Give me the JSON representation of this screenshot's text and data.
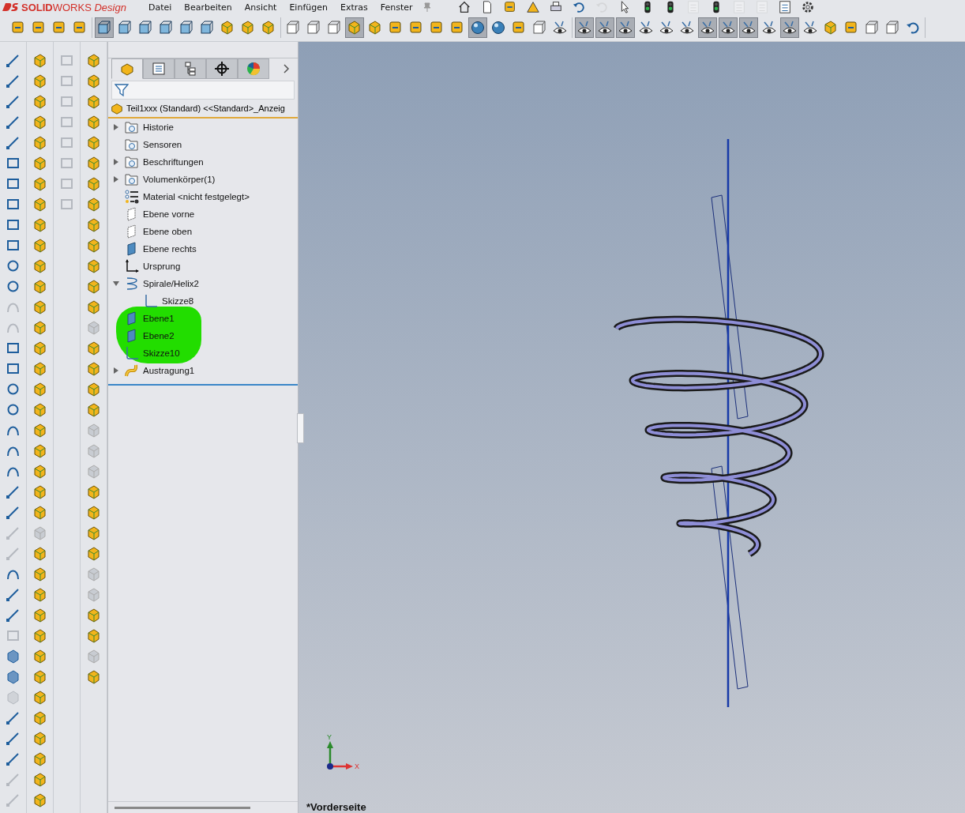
{
  "app": {
    "logo": "**SOLID**WORKS *Design*"
  },
  "menu": [
    "Datei",
    "Bearbeiten",
    "Ansicht",
    "Einfügen",
    "Extras",
    "Fenster"
  ],
  "quick_access": [
    {
      "kind": "home",
      "disabled": false
    },
    {
      "kind": "doc",
      "disabled": false
    },
    {
      "kind": "tool",
      "disabled": false
    },
    {
      "kind": "warn",
      "disabled": false
    },
    {
      "kind": "print",
      "disabled": false
    },
    {
      "kind": "undo",
      "disabled": false
    },
    {
      "kind": "undo",
      "disabled": true
    },
    {
      "kind": "cursor",
      "disabled": false
    },
    {
      "kind": "light",
      "disabled": false
    },
    {
      "kind": "light",
      "disabled": false
    },
    {
      "kind": "list",
      "disabled": true
    },
    {
      "kind": "light",
      "disabled": false
    },
    {
      "kind": "list",
      "disabled": true
    },
    {
      "kind": "list",
      "disabled": true
    },
    {
      "kind": "list",
      "disabled": false
    },
    {
      "kind": "gear",
      "disabled": false
    }
  ],
  "toolbar": [
    [
      {
        "kind": "tool",
        "pressed": false
      },
      {
        "kind": "tool",
        "pressed": false
      },
      {
        "kind": "tool",
        "pressed": false
      },
      {
        "kind": "tool",
        "pressed": false
      }
    ],
    [
      {
        "kind": "view",
        "pressed": true
      },
      {
        "kind": "view",
        "pressed": false
      },
      {
        "kind": "view",
        "pressed": false
      },
      {
        "kind": "view",
        "pressed": false
      },
      {
        "kind": "view",
        "pressed": false
      },
      {
        "kind": "view",
        "pressed": false
      },
      {
        "kind": "solid",
        "pressed": false
      },
      {
        "kind": "solid",
        "pressed": false
      },
      {
        "kind": "solid",
        "pressed": false
      }
    ],
    [
      {
        "kind": "wire",
        "pressed": false
      },
      {
        "kind": "wire",
        "pressed": false
      },
      {
        "kind": "wire",
        "pressed": false
      },
      {
        "kind": "solid",
        "pressed": true
      },
      {
        "kind": "solid",
        "pressed": false
      },
      {
        "kind": "tool",
        "pressed": false
      },
      {
        "kind": "tool",
        "pressed": false
      },
      {
        "kind": "tool",
        "pressed": false
      },
      {
        "kind": "tool",
        "pressed": false
      },
      {
        "kind": "sphere",
        "pressed": true
      },
      {
        "kind": "sphere",
        "pressed": false
      },
      {
        "kind": "tool",
        "pressed": false
      },
      {
        "kind": "wire",
        "pressed": false
      },
      {
        "kind": "eye",
        "pressed": false
      }
    ],
    [
      {
        "kind": "eye",
        "pressed": true
      },
      {
        "kind": "eye",
        "pressed": true
      },
      {
        "kind": "eye",
        "pressed": true
      },
      {
        "kind": "eye",
        "pressed": false
      },
      {
        "kind": "eye",
        "pressed": false
      },
      {
        "kind": "eye",
        "pressed": false
      },
      {
        "kind": "eye",
        "pressed": true
      },
      {
        "kind": "eye",
        "pressed": true
      },
      {
        "kind": "eye",
        "pressed": true
      },
      {
        "kind": "eye",
        "pressed": false
      },
      {
        "kind": "eye",
        "pressed": true
      },
      {
        "kind": "eye",
        "pressed": false
      },
      {
        "kind": "solid",
        "pressed": false
      },
      {
        "kind": "tool",
        "pressed": false
      },
      {
        "kind": "wire",
        "pressed": false
      },
      {
        "kind": "wire",
        "pressed": false
      },
      {
        "kind": "undo",
        "pressed": false
      }
    ]
  ],
  "palettes": [
    {
      "icons": [
        {
          "kind": "line",
          "disabled": false
        },
        {
          "kind": "line",
          "disabled": false
        },
        {
          "kind": "line",
          "disabled": false
        },
        {
          "kind": "line",
          "disabled": false
        },
        {
          "kind": "line",
          "disabled": false
        },
        {
          "kind": "rect",
          "disabled": false
        },
        {
          "kind": "rect",
          "disabled": false
        },
        {
          "kind": "rect",
          "disabled": false
        },
        {
          "kind": "rect",
          "disabled": false
        },
        {
          "kind": "rect",
          "disabled": false
        },
        {
          "kind": "circle",
          "disabled": false
        },
        {
          "kind": "circle",
          "disabled": false
        },
        {
          "kind": "curve",
          "disabled": true
        },
        {
          "kind": "curve",
          "disabled": true
        },
        {
          "kind": "rect",
          "disabled": false
        },
        {
          "kind": "rect",
          "disabled": false
        },
        {
          "kind": "circle",
          "disabled": false
        },
        {
          "kind": "circle",
          "disabled": false
        },
        {
          "kind": "curve",
          "disabled": false
        },
        {
          "kind": "curve",
          "disabled": false
        },
        {
          "kind": "curve",
          "disabled": false
        },
        {
          "kind": "line",
          "disabled": false
        },
        {
          "kind": "line",
          "disabled": false
        },
        {
          "kind": "line",
          "disabled": true
        },
        {
          "kind": "line",
          "disabled": true
        },
        {
          "kind": "curve",
          "disabled": false
        },
        {
          "kind": "line",
          "disabled": false
        },
        {
          "kind": "line",
          "disabled": false
        },
        {
          "kind": "rect",
          "disabled": true
        },
        {
          "kind": "cube",
          "disabled": false
        },
        {
          "kind": "cube",
          "disabled": false
        },
        {
          "kind": "cube",
          "disabled": true
        },
        {
          "kind": "line",
          "disabled": false
        },
        {
          "kind": "line",
          "disabled": false
        },
        {
          "kind": "line",
          "disabled": false
        },
        {
          "kind": "line",
          "disabled": true
        },
        {
          "kind": "line",
          "disabled": true
        }
      ]
    },
    {
      "icons": [
        {
          "kind": "solid",
          "disabled": false
        },
        {
          "kind": "solid",
          "disabled": false
        },
        {
          "kind": "solid",
          "disabled": false
        },
        {
          "kind": "solid",
          "disabled": false
        },
        {
          "kind": "solid",
          "disabled": false
        },
        {
          "kind": "solid",
          "disabled": false
        },
        {
          "kind": "solid",
          "disabled": false
        },
        {
          "kind": "solid",
          "disabled": false
        },
        {
          "kind": "solid",
          "disabled": false
        },
        {
          "kind": "solid",
          "disabled": false
        },
        {
          "kind": "solid",
          "disabled": false
        },
        {
          "kind": "solid",
          "disabled": false
        },
        {
          "kind": "solid",
          "disabled": false
        },
        {
          "kind": "solid",
          "disabled": false
        },
        {
          "kind": "solid",
          "disabled": false
        },
        {
          "kind": "solid",
          "disabled": false
        },
        {
          "kind": "solid",
          "disabled": false
        },
        {
          "kind": "solid",
          "disabled": false
        },
        {
          "kind": "solid",
          "disabled": false
        },
        {
          "kind": "solid",
          "disabled": false
        },
        {
          "kind": "solid",
          "disabled": false
        },
        {
          "kind": "solid",
          "disabled": false
        },
        {
          "kind": "solid",
          "disabled": false
        },
        {
          "kind": "solid",
          "disabled": true
        },
        {
          "kind": "solid",
          "disabled": false
        },
        {
          "kind": "solid",
          "disabled": false
        },
        {
          "kind": "solid",
          "disabled": false
        },
        {
          "kind": "solid",
          "disabled": false
        },
        {
          "kind": "solid",
          "disabled": false
        },
        {
          "kind": "solid",
          "disabled": false
        },
        {
          "kind": "solid",
          "disabled": false
        },
        {
          "kind": "solid",
          "disabled": false
        },
        {
          "kind": "solid",
          "disabled": false
        },
        {
          "kind": "solid",
          "disabled": false
        },
        {
          "kind": "solid",
          "disabled": false
        },
        {
          "kind": "solid",
          "disabled": false
        },
        {
          "kind": "solid",
          "disabled": false
        }
      ]
    },
    {
      "icons": [
        {
          "kind": "rect",
          "disabled": true
        },
        {
          "kind": "rect",
          "disabled": true
        },
        {
          "kind": "rect",
          "disabled": true
        },
        {
          "kind": "rect",
          "disabled": true
        },
        {
          "kind": "rect",
          "disabled": true
        },
        {
          "kind": "rect",
          "disabled": true
        },
        {
          "kind": "rect",
          "disabled": true
        },
        {
          "kind": "rect",
          "disabled": true
        }
      ]
    },
    {
      "icons": [
        {
          "kind": "solid",
          "disabled": false
        },
        {
          "kind": "solid",
          "disabled": false
        },
        {
          "kind": "solid",
          "disabled": false
        },
        {
          "kind": "solid",
          "disabled": false
        },
        {
          "kind": "solid",
          "disabled": false
        },
        {
          "kind": "solid",
          "disabled": false
        },
        {
          "kind": "solid",
          "disabled": false
        },
        {
          "kind": "solid",
          "disabled": false
        },
        {
          "kind": "solid",
          "disabled": false
        },
        {
          "kind": "solid",
          "disabled": false
        },
        {
          "kind": "solid",
          "disabled": false
        },
        {
          "kind": "solid",
          "disabled": false
        },
        {
          "kind": "solid",
          "disabled": false
        },
        {
          "kind": "solid",
          "disabled": true
        },
        {
          "kind": "solid",
          "disabled": false
        },
        {
          "kind": "solid",
          "disabled": false
        },
        {
          "kind": "solid",
          "disabled": false
        },
        {
          "kind": "solid",
          "disabled": false
        },
        {
          "kind": "solid",
          "disabled": true
        },
        {
          "kind": "solid",
          "disabled": true
        },
        {
          "kind": "solid",
          "disabled": true
        },
        {
          "kind": "solid",
          "disabled": false
        },
        {
          "kind": "solid",
          "disabled": false
        },
        {
          "kind": "solid",
          "disabled": false
        },
        {
          "kind": "solid",
          "disabled": false
        },
        {
          "kind": "solid",
          "disabled": true
        },
        {
          "kind": "solid",
          "disabled": true
        },
        {
          "kind": "solid",
          "disabled": false
        },
        {
          "kind": "solid",
          "disabled": false
        },
        {
          "kind": "solid",
          "disabled": true
        },
        {
          "kind": "solid",
          "disabled": false
        }
      ]
    }
  ],
  "panel_tabs": [
    {
      "kind": "part",
      "selected": true
    },
    {
      "kind": "list",
      "selected": false
    },
    {
      "kind": "config",
      "selected": false
    },
    {
      "kind": "target",
      "selected": false
    },
    {
      "kind": "color",
      "selected": false
    }
  ],
  "tree": {
    "root": "Teil1xxx (Standard) <<Standard>_Anzeig",
    "items": [
      {
        "label": "Historie",
        "kind": "folder",
        "expanded": false
      },
      {
        "label": "Sensoren",
        "kind": "folder"
      },
      {
        "label": "Beschriftungen",
        "kind": "folder",
        "expanded": false
      },
      {
        "label": "Volumenkörper(1)",
        "kind": "folder",
        "expanded": false
      },
      {
        "label": "Material <nicht festgelegt>",
        "kind": "material"
      },
      {
        "label": "Ebene vorne",
        "kind": "plane"
      },
      {
        "label": "Ebene oben",
        "kind": "plane"
      },
      {
        "label": "Ebene rechts",
        "kind": "plane-filled"
      },
      {
        "label": "Ursprung",
        "kind": "origin"
      },
      {
        "label": "Spirale/Helix2",
        "kind": "helix",
        "expanded": true,
        "children": [
          {
            "label": "Skizze8",
            "kind": "sketch"
          }
        ]
      },
      {
        "label": "Ebene1",
        "kind": "plane-filled"
      },
      {
        "label": "Ebene2",
        "kind": "plane-filled"
      },
      {
        "label": "Skizze10",
        "kind": "sketch"
      },
      {
        "label": "Austragung1",
        "kind": "sweep",
        "expanded": false
      }
    ]
  },
  "annotation": {
    "kind": "highlight",
    "color": "#22dd00"
  },
  "viewport": {
    "axis_x": "X",
    "axis_y": "Y",
    "view_name": "*Vorderseite"
  }
}
